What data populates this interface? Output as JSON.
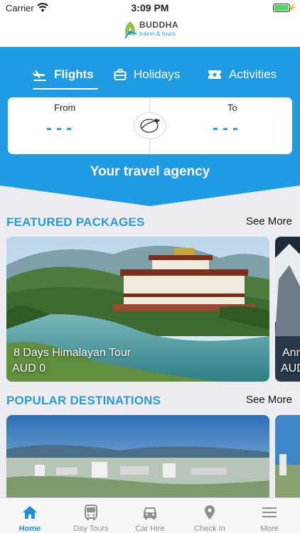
{
  "status_bar": {
    "carrier": "Carrier",
    "time": "3:09 PM"
  },
  "header": {
    "logo_title": "BUDDHA",
    "logo_subtitle": "travel & tours"
  },
  "tabs": [
    {
      "label": "Flights",
      "icon": "airplane-takeoff-icon",
      "active": true
    },
    {
      "label": "Holidays",
      "icon": "suitcase-icon",
      "active": false
    },
    {
      "label": "Activities",
      "icon": "ticket-icon",
      "active": false
    }
  ],
  "route": {
    "from_label": "From",
    "from_value": "---",
    "to_label": "To",
    "to_value": "---"
  },
  "tagline": "Your travel agency",
  "featured": {
    "title": "FEATURED PACKAGES",
    "see_more": "See More",
    "cards": [
      {
        "title": "8 Days Himalayan Tour",
        "price": "AUD 0"
      },
      {
        "title": "Ann",
        "price": "AUD"
      }
    ]
  },
  "popular": {
    "title": "POPULAR DESTINATIONS",
    "see_more": "See More"
  },
  "tab_bar": [
    {
      "label": "Home",
      "icon": "home-icon",
      "active": true
    },
    {
      "label": "Day Tours",
      "icon": "bus-icon",
      "active": false
    },
    {
      "label": "Car Hire",
      "icon": "car-icon",
      "active": false
    },
    {
      "label": "Check In",
      "icon": "location-pin-icon",
      "active": false
    },
    {
      "label": "More",
      "icon": "menu-icon",
      "active": false
    }
  ],
  "colors": {
    "primary": "#1f9be4",
    "accent_text": "#2b9bd8",
    "tab_active": "#1f8fe0",
    "tab_inactive": "#8d8d92"
  }
}
